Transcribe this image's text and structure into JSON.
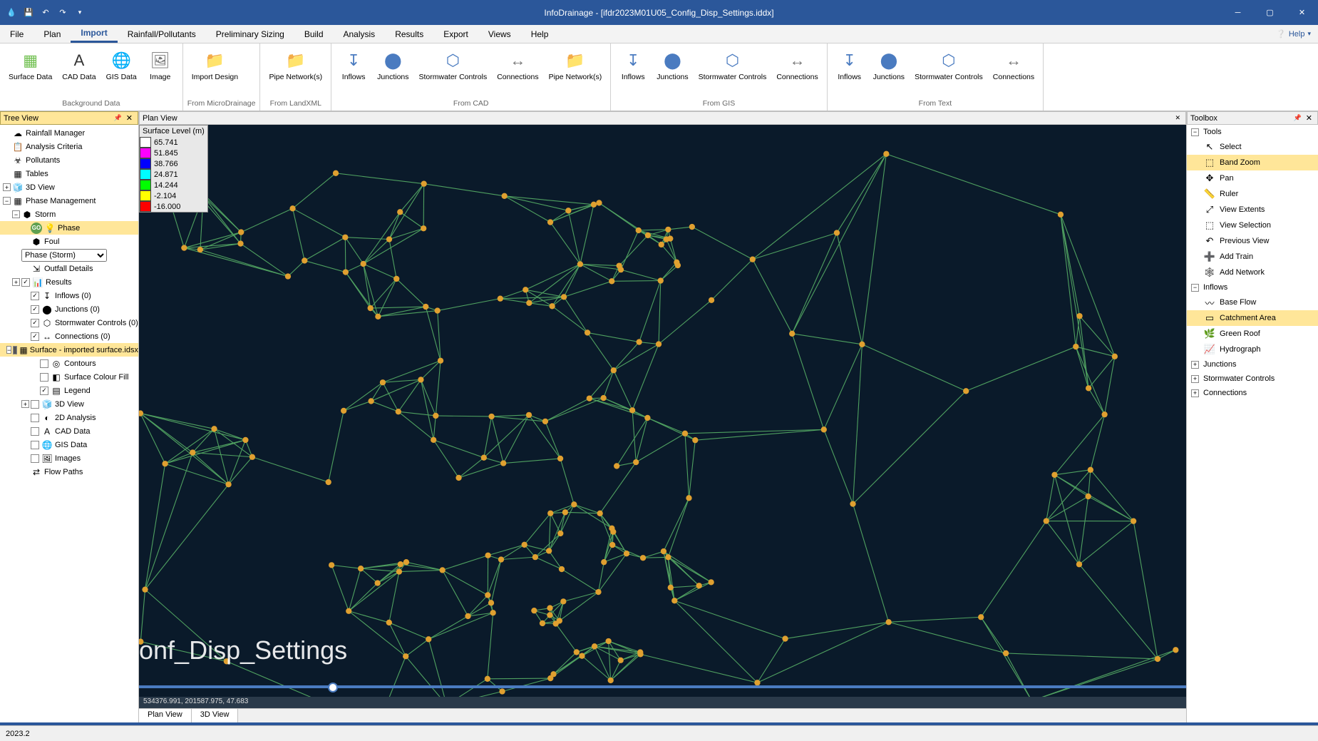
{
  "title": "InfoDrainage - [ifdr2023M01U05_Config_Disp_Settings.iddx]",
  "menu": [
    "File",
    "Plan",
    "Import",
    "Rainfall/Pollutants",
    "Preliminary Sizing",
    "Build",
    "Analysis",
    "Results",
    "Export",
    "Views",
    "Help"
  ],
  "menu_active_index": 2,
  "help_label": "Help",
  "ribbon_groups": [
    {
      "label": "Background Data",
      "buttons": [
        {
          "label": "Surface Data",
          "icon": "▦",
          "color": "#6fbf4f"
        },
        {
          "label": "CAD Data",
          "icon": "A",
          "color": "#333"
        },
        {
          "label": "GIS Data",
          "icon": "🌐",
          "color": "#2b6fbf"
        },
        {
          "label": "Image",
          "icon": "🖼",
          "color": "#777"
        }
      ]
    },
    {
      "label": "From MicroDrainage",
      "buttons": [
        {
          "label": "Import Design",
          "icon": "📁",
          "color": "#e0a030"
        }
      ]
    },
    {
      "label": "From LandXML",
      "buttons": [
        {
          "label": "Pipe Network(s)",
          "icon": "📁",
          "color": "#e0a030"
        }
      ]
    },
    {
      "label": "From CAD",
      "buttons": [
        {
          "label": "Inflows",
          "icon": "↧",
          "color": "#4a7bc0"
        },
        {
          "label": "Junctions",
          "icon": "⬤",
          "color": "#4a7bc0"
        },
        {
          "label": "Stormwater Controls",
          "icon": "⬡",
          "color": "#4a7bc0"
        },
        {
          "label": "Connections",
          "icon": "↔",
          "color": "#777"
        },
        {
          "label": "Pipe Network(s)",
          "icon": "📁",
          "color": "#e0a030"
        }
      ]
    },
    {
      "label": "From GIS",
      "buttons": [
        {
          "label": "Inflows",
          "icon": "↧",
          "color": "#4a7bc0"
        },
        {
          "label": "Junctions",
          "icon": "⬤",
          "color": "#4a7bc0"
        },
        {
          "label": "Stormwater Controls",
          "icon": "⬡",
          "color": "#4a7bc0"
        },
        {
          "label": "Connections",
          "icon": "↔",
          "color": "#777"
        }
      ]
    },
    {
      "label": "From Text",
      "buttons": [
        {
          "label": "Inflows",
          "icon": "↧",
          "color": "#4a7bc0"
        },
        {
          "label": "Junctions",
          "icon": "⬤",
          "color": "#4a7bc0"
        },
        {
          "label": "Stormwater Controls",
          "icon": "⬡",
          "color": "#4a7bc0"
        },
        {
          "label": "Connections",
          "icon": "↔",
          "color": "#777"
        }
      ]
    }
  ],
  "treeview": {
    "title": "Tree View",
    "phase_select": "Phase (Storm)",
    "items": [
      {
        "indent": 0,
        "icon": "☁",
        "label": "Rainfall Manager"
      },
      {
        "indent": 0,
        "icon": "📋",
        "label": "Analysis Criteria"
      },
      {
        "indent": 0,
        "icon": "☣",
        "label": "Pollutants"
      },
      {
        "indent": 0,
        "icon": "▦",
        "label": "Tables"
      },
      {
        "indent": 0,
        "exp": "+",
        "icon": "🧊",
        "label": "3D View"
      },
      {
        "indent": 0,
        "exp": "−",
        "icon": "▦",
        "label": "Phase Management"
      },
      {
        "indent": 1,
        "exp": "−",
        "icon": "⬢",
        "label": "Storm"
      },
      {
        "indent": 2,
        "icon": "💡",
        "go": true,
        "label": "Phase"
      },
      {
        "indent": 2,
        "icon": "⬢",
        "label": "Foul"
      },
      {
        "indent": 1,
        "select": true
      },
      {
        "indent": 2,
        "icon": "⇲",
        "label": "Outfall Details"
      },
      {
        "indent": 1,
        "exp": "+",
        "chk": "checked",
        "icon": "📊",
        "label": "Results"
      },
      {
        "indent": 2,
        "chk": "checked",
        "icon": "↧",
        "label": "Inflows (0)"
      },
      {
        "indent": 2,
        "chk": "checked",
        "icon": "⬤",
        "label": "Junctions (0)"
      },
      {
        "indent": 2,
        "chk": "checked",
        "icon": "⬡",
        "label": "Stormwater Controls (0)"
      },
      {
        "indent": 2,
        "chk": "checked",
        "icon": "↔",
        "label": "Connections (0)"
      },
      {
        "indent": 1,
        "exp": "−",
        "chk": "mixed",
        "icon": "▦",
        "label": "Surface - imported surface.idsx",
        "sel": true
      },
      {
        "indent": 3,
        "chk": "",
        "icon": "◎",
        "label": "Contours"
      },
      {
        "indent": 3,
        "chk": "",
        "icon": "◧",
        "label": "Surface Colour Fill"
      },
      {
        "indent": 3,
        "chk": "checked",
        "icon": "▤",
        "label": "Legend"
      },
      {
        "indent": 2,
        "exp": "+",
        "chk": "",
        "icon": "🧊",
        "label": "3D View"
      },
      {
        "indent": 2,
        "chk": "",
        "icon": "◐",
        "label": "2D Analysis"
      },
      {
        "indent": 2,
        "chk": "",
        "icon": "A",
        "label": "CAD Data"
      },
      {
        "indent": 2,
        "chk": "",
        "icon": "🌐",
        "label": "GIS Data"
      },
      {
        "indent": 2,
        "chk": "",
        "icon": "🖼",
        "label": "Images"
      },
      {
        "indent": 2,
        "icon": "⇄",
        "label": "Flow Paths"
      }
    ]
  },
  "planview": {
    "title": "Plan View",
    "legend_title": "Surface Level (m)",
    "legend": [
      {
        "c": "#ffffff",
        "v": "65.741"
      },
      {
        "c": "#ff00ff",
        "v": "51.845"
      },
      {
        "c": "#0000ff",
        "v": "38.766"
      },
      {
        "c": "#00ffff",
        "v": "24.871"
      },
      {
        "c": "#00ff00",
        "v": "14.244"
      },
      {
        "c": "#ffff00",
        "v": "-2.104"
      },
      {
        "c": "#ff0000",
        "v": "-16.000"
      }
    ],
    "watermark": "onf_Disp_Settings",
    "coords": "534376.991, 201587.975, 47.683",
    "tabs": [
      "Plan View",
      "3D View"
    ]
  },
  "toolbox": {
    "title": "Toolbox",
    "sections": [
      {
        "label": "Tools",
        "exp": "−",
        "items": [
          {
            "icon": "↖",
            "label": "Select"
          },
          {
            "icon": "⬚",
            "label": "Band Zoom",
            "sel": true
          },
          {
            "icon": "✥",
            "label": "Pan"
          },
          {
            "icon": "📏",
            "label": "Ruler"
          },
          {
            "icon": "⤢",
            "label": "View Extents"
          },
          {
            "icon": "⬚",
            "label": "View Selection"
          },
          {
            "icon": "↶",
            "label": "Previous View"
          },
          {
            "icon": "➕",
            "label": "Add Train"
          },
          {
            "icon": "🕸",
            "label": "Add Network"
          }
        ]
      },
      {
        "label": "Inflows",
        "exp": "−",
        "items": [
          {
            "icon": "〰",
            "label": "Base Flow"
          },
          {
            "icon": "▭",
            "label": "Catchment Area",
            "sel": true
          },
          {
            "icon": "🌿",
            "label": "Green Roof"
          },
          {
            "icon": "📈",
            "label": "Hydrograph"
          }
        ]
      },
      {
        "label": "Junctions",
        "exp": "+",
        "items": []
      },
      {
        "label": "Stormwater Controls",
        "exp": "+",
        "items": []
      },
      {
        "label": "Connections",
        "exp": "+",
        "items": []
      }
    ]
  },
  "status": {
    "version": "2023.2"
  }
}
